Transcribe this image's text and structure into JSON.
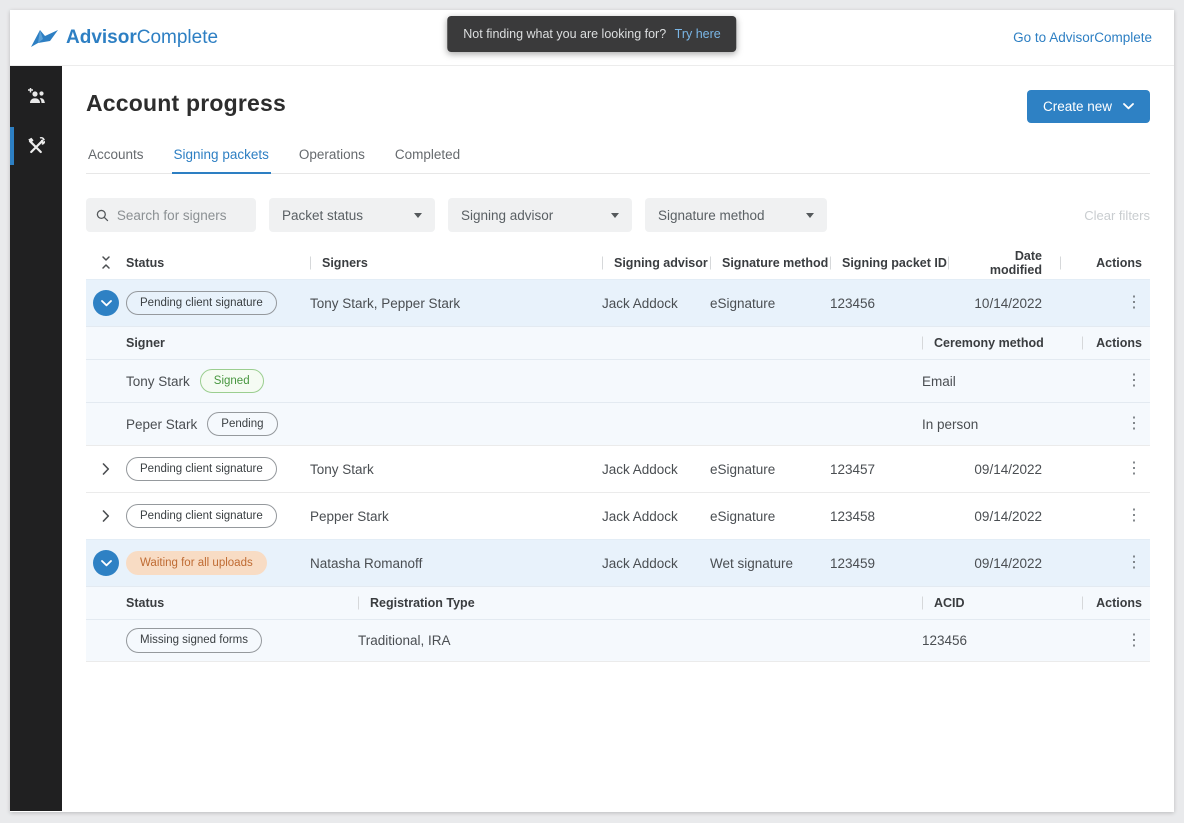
{
  "app": {
    "brand_bold": "Advisor",
    "brand_light": "Complete",
    "tooltip": {
      "text": "Not finding what you are looking for?",
      "link": "Try here"
    },
    "go_link": "Go to AdvisorComplete"
  },
  "page": {
    "title": "Account progress",
    "create_button_label": "Create new",
    "tabs": [
      {
        "label": "Accounts",
        "active": false
      },
      {
        "label": "Signing packets",
        "active": true
      },
      {
        "label": "Operations",
        "active": false
      },
      {
        "label": "Completed",
        "active": false
      }
    ]
  },
  "filters": {
    "search_placeholder": "Search for signers",
    "packet_status_label": "Packet status",
    "signing_advisor_label": "Signing advisor",
    "signature_method_label": "Signature method",
    "clear_label": "Clear filters"
  },
  "table": {
    "headers": {
      "status": "Status",
      "signers": "Signers",
      "signing_advisor": "Signing advisor",
      "signature_method": "Signature method",
      "packet_id": "Signing packet ID",
      "date_modified": "Date modified",
      "actions": "Actions"
    },
    "rows": [
      {
        "status": "Pending client signature",
        "status_style": "outline",
        "expanded": true,
        "signers": "Tony Stark, Pepper Stark",
        "signing_advisor": "Jack Addock",
        "signature_method": "eSignature",
        "packet_id": "123456",
        "date_modified": "10/14/2022"
      },
      {
        "status": "Pending client signature",
        "status_style": "outline",
        "expanded": false,
        "signers": "Tony Stark",
        "signing_advisor": "Jack Addock",
        "signature_method": "eSignature",
        "packet_id": "123457",
        "date_modified": "09/14/2022"
      },
      {
        "status": "Pending client signature",
        "status_style": "outline",
        "expanded": false,
        "signers": "Pepper Stark",
        "signing_advisor": "Jack Addock",
        "signature_method": "eSignature",
        "packet_id": "123458",
        "date_modified": "09/14/2022"
      },
      {
        "status": "Waiting for all uploads",
        "status_style": "orange",
        "expanded": true,
        "signers": "Natasha Romanoff",
        "signing_advisor": "Jack Addock",
        "signature_method": "Wet signature",
        "packet_id": "123459",
        "date_modified": "09/14/2022"
      }
    ],
    "signer_subtable": {
      "headers": {
        "signer": "Signer",
        "ceremony_method": "Ceremony method",
        "actions": "Actions"
      },
      "rows": [
        {
          "name": "Tony Stark",
          "badge": "Signed",
          "badge_style": "green",
          "ceremony_method": "Email"
        },
        {
          "name": "Peper Stark",
          "badge": "Pending",
          "badge_style": "outline",
          "ceremony_method": "In person"
        }
      ]
    },
    "account_subtable": {
      "headers": {
        "status": "Status",
        "registration_type": "Registration Type",
        "acid": "ACID",
        "actions": "Actions"
      },
      "rows": [
        {
          "status": "Missing signed forms",
          "status_style": "outline",
          "registration_type": "Traditional, IRA",
          "acid": "123456"
        }
      ]
    }
  },
  "icons": {
    "kebab": "⋮"
  },
  "colors": {
    "accent_blue": "#2d7fc3",
    "sidebar_bg": "#202021",
    "tooltip_bg": "#3a3a3b",
    "tooltip_link": "#7ab6e6",
    "row_highlight": "#e8f2fb",
    "subtable_bg": "#f5f9fd",
    "badge_green_text": "#47963f",
    "badge_green_border": "#9bce90",
    "badge_orange_bg": "#f8dcc4",
    "badge_orange_text": "#bf6b33"
  }
}
